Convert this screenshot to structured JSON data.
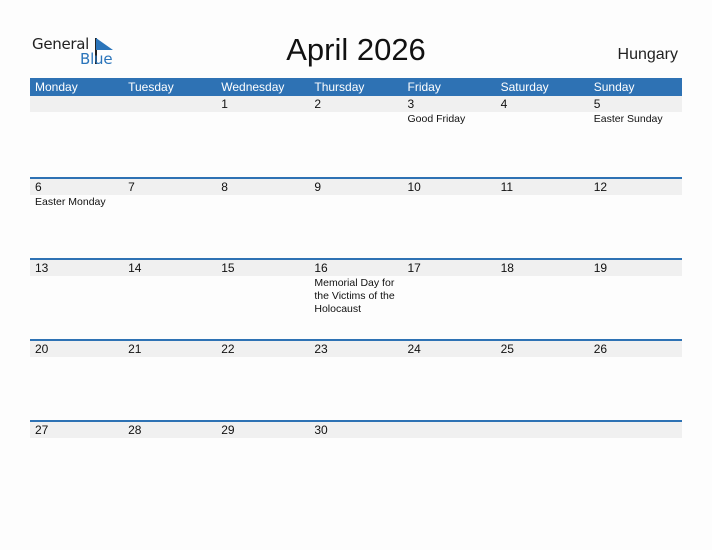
{
  "logo": {
    "word1": "General",
    "word2": "Blue",
    "accent": "#2a74ba"
  },
  "title": "April 2026",
  "country": "Hungary",
  "header_color": "#2e72b4",
  "weekdays": [
    "Monday",
    "Tuesday",
    "Wednesday",
    "Thursday",
    "Friday",
    "Saturday",
    "Sunday"
  ],
  "weeks": [
    {
      "days": [
        "",
        "",
        "1",
        "2",
        "3",
        "4",
        "5"
      ],
      "events": [
        "",
        "",
        "",
        "",
        "Good Friday",
        "",
        "Easter Sunday"
      ]
    },
    {
      "days": [
        "6",
        "7",
        "8",
        "9",
        "10",
        "11",
        "12"
      ],
      "events": [
        "Easter Monday",
        "",
        "",
        "",
        "",
        "",
        ""
      ]
    },
    {
      "days": [
        "13",
        "14",
        "15",
        "16",
        "17",
        "18",
        "19"
      ],
      "events": [
        "",
        "",
        "",
        "Memorial Day for the Victims of the Holocaust",
        "",
        "",
        ""
      ]
    },
    {
      "days": [
        "20",
        "21",
        "22",
        "23",
        "24",
        "25",
        "26"
      ],
      "events": [
        "",
        "",
        "",
        "",
        "",
        "",
        ""
      ]
    },
    {
      "days": [
        "27",
        "28",
        "29",
        "30",
        "",
        "",
        ""
      ],
      "events": [
        "",
        "",
        "",
        "",
        "",
        "",
        ""
      ]
    }
  ]
}
